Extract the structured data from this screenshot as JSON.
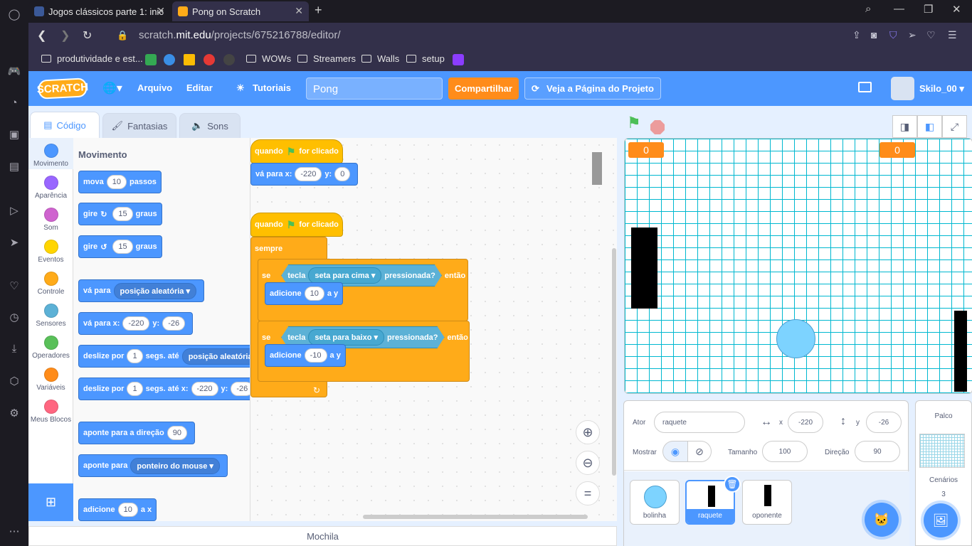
{
  "browser": {
    "tabs": [
      {
        "title": "Jogos clássicos parte 1: inic"
      },
      {
        "title": "Pong on Scratch"
      }
    ],
    "url_prefix": "scratch.",
    "url_domain": "mit.edu",
    "url_path": "/projects/675216788/editor/",
    "bookmarks": [
      "produtividade e est...",
      "WOWs",
      "Streamers",
      "Walls",
      "setup"
    ]
  },
  "menubar": {
    "logo": "SCRATCH",
    "file": "Arquivo",
    "edit": "Editar",
    "tutorials": "Tutoriais",
    "project_title": "Pong",
    "share": "Compartilhar",
    "see_project": "Veja a Página do Projeto",
    "username": "Skilo_00"
  },
  "editor_tabs": {
    "code": "Código",
    "costumes": "Fantasias",
    "sounds": "Sons"
  },
  "categories": [
    {
      "label": "Movimento",
      "color": "#4c97ff"
    },
    {
      "label": "Aparência",
      "color": "#9966ff"
    },
    {
      "label": "Som",
      "color": "#cf63cf"
    },
    {
      "label": "Eventos",
      "color": "#ffd500"
    },
    {
      "label": "Controle",
      "color": "#ffab19"
    },
    {
      "label": "Sensores",
      "color": "#5cb1d6"
    },
    {
      "label": "Operadores",
      "color": "#59c059"
    },
    {
      "label": "Variáveis",
      "color": "#ff8c1a"
    },
    {
      "label": "Meus Blocos",
      "color": "#ff6680"
    }
  ],
  "palette": {
    "heading": "Movimento",
    "move": {
      "a": "mova",
      "v": "10",
      "b": "passos"
    },
    "turn_right": {
      "a": "gire",
      "v": "15",
      "b": "graus"
    },
    "turn_left": {
      "a": "gire",
      "v": "15",
      "b": "graus"
    },
    "goto": {
      "a": "vá para",
      "dd": "posição aleatória"
    },
    "goto_xy": {
      "a": "vá para x:",
      "x": "-220",
      "b": "y:",
      "y": "-26"
    },
    "glide": {
      "a": "deslize por",
      "v": "1",
      "b": "segs. até",
      "dd": "posição aleatória"
    },
    "glide_xy": {
      "a": "deslize por",
      "v": "1",
      "b": "segs. até x:",
      "x": "-220",
      "c": "y:",
      "y": "-26"
    },
    "point_dir": {
      "a": "aponte  para a direção",
      "v": "90"
    },
    "point_to": {
      "a": "aponte para",
      "dd": "ponteiro do mouse"
    },
    "change_x": {
      "a": "adicione",
      "v": "10",
      "b": "a x"
    }
  },
  "script": {
    "hat1": {
      "a": "quando",
      "b": "for clicado"
    },
    "goto1": {
      "a": "vá para x:",
      "x": "-220",
      "b": "y:",
      "y": "0"
    },
    "hat2": {
      "a": "quando",
      "b": "for clicado"
    },
    "forever": "sempre",
    "if1": {
      "a": "se",
      "key": "tecla",
      "dd": "seta para cima",
      "pressed": "pressionada?",
      "then": "então"
    },
    "change1": {
      "a": "adicione",
      "v": "10",
      "b": "a y"
    },
    "if2": {
      "a": "se",
      "key": "tecla",
      "dd": "seta para baixo",
      "pressed": "pressionada?",
      "then": "então"
    },
    "change2": {
      "a": "adicione",
      "v": "-10",
      "b": "a y"
    }
  },
  "backpack": "Mochila",
  "stage": {
    "score_left": "0",
    "score_right": "0"
  },
  "sprite_info": {
    "sprite_label": "Ator",
    "sprite_name": "raquete",
    "x_label": "x",
    "x": "-220",
    "y_label": "y",
    "y": "-26",
    "show_label": "Mostrar",
    "size_label": "Tamanho",
    "size": "100",
    "direction_label": "Direção",
    "direction": "90"
  },
  "sprites": [
    {
      "name": "bolinha"
    },
    {
      "name": "raquete"
    },
    {
      "name": "oponente"
    }
  ],
  "stage_pane": {
    "label": "Palco",
    "backdrops_label": "Cenários",
    "backdrops_count": "3"
  }
}
